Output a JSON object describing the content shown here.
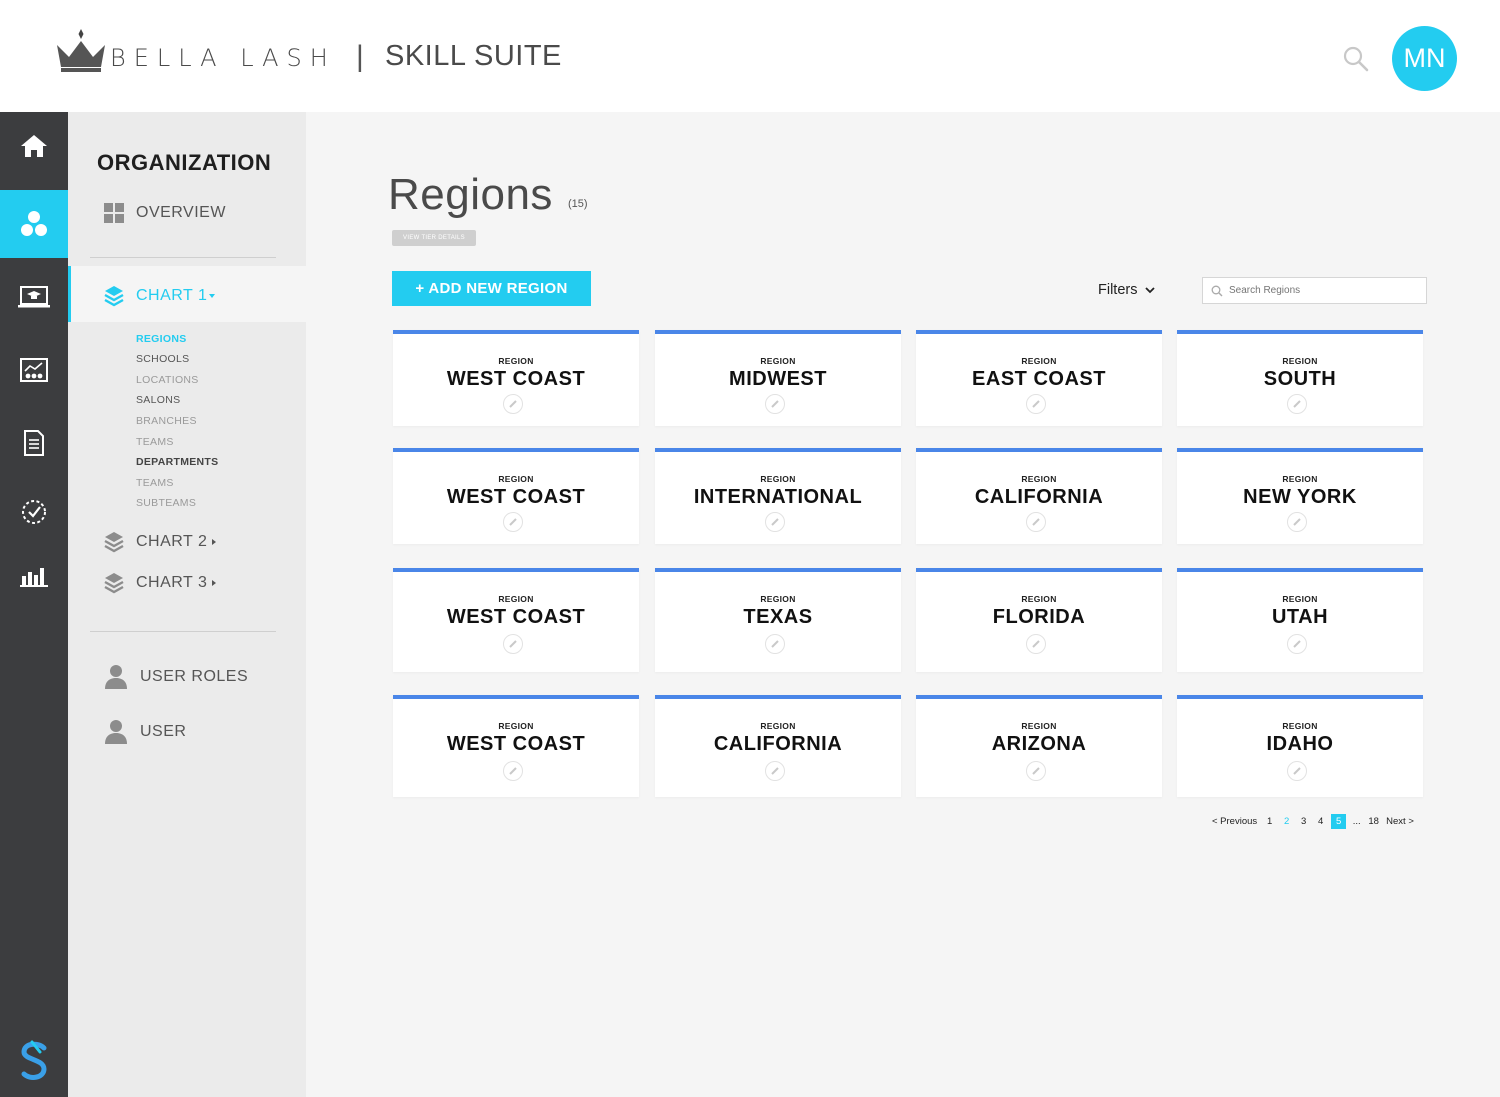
{
  "header": {
    "brand": "BELLA LASH",
    "separator": "|",
    "product": "SKILL SUITE",
    "avatar_initials": "MN"
  },
  "rail": {
    "items": [
      {
        "icon": "home-icon"
      },
      {
        "icon": "org-chart-icon",
        "active": true
      },
      {
        "icon": "laptop-course-icon"
      },
      {
        "icon": "presentation-icon"
      },
      {
        "icon": "document-icon"
      },
      {
        "icon": "checklist-icon"
      },
      {
        "icon": "bar-chart-icon"
      }
    ],
    "logo": "skill-suite-logo"
  },
  "sidenav": {
    "title": "ORGANIZATION",
    "overview": "OVERVIEW",
    "chart1": "CHART 1",
    "chart1_subitems": [
      "REGIONS",
      "SCHOOLS",
      "LOCATIONS",
      "SALONS",
      "BRANCHES",
      "TEAMS",
      "DEPARTMENTS",
      "TEAMS",
      "SUBTEAMS"
    ],
    "chart2": "CHART 2",
    "chart3": "CHART 3",
    "user_roles": "USER ROLES",
    "user": "USER"
  },
  "main": {
    "title": "Regions",
    "count": "(15)",
    "tier_button": "VIEW TIER DETAILS",
    "add_button": "+ ADD NEW REGION",
    "filters": "Filters",
    "search_placeholder": "Search Regions",
    "card_kicker": "REGION",
    "regions": [
      "WEST COAST",
      "MIDWEST",
      "EAST COAST",
      "SOUTH",
      "WEST COAST",
      "INTERNATIONAL",
      "CALIFORNIA",
      "NEW YORK",
      "WEST COAST",
      "TEXAS",
      "FLORIDA",
      "UTAH",
      "WEST COAST",
      "CALIFORNIA",
      "ARIZONA",
      "IDAHO"
    ]
  },
  "pagination": {
    "previous": "< Previous",
    "pages": [
      "1",
      "2",
      "3",
      "4",
      "5",
      "...",
      "18"
    ],
    "current": "5",
    "next": "Next >"
  },
  "colors": {
    "accent": "#23ccf0",
    "card_top": "#4a86e8",
    "rail": "#3c3d3f",
    "sidenav": "#ebebeb"
  }
}
